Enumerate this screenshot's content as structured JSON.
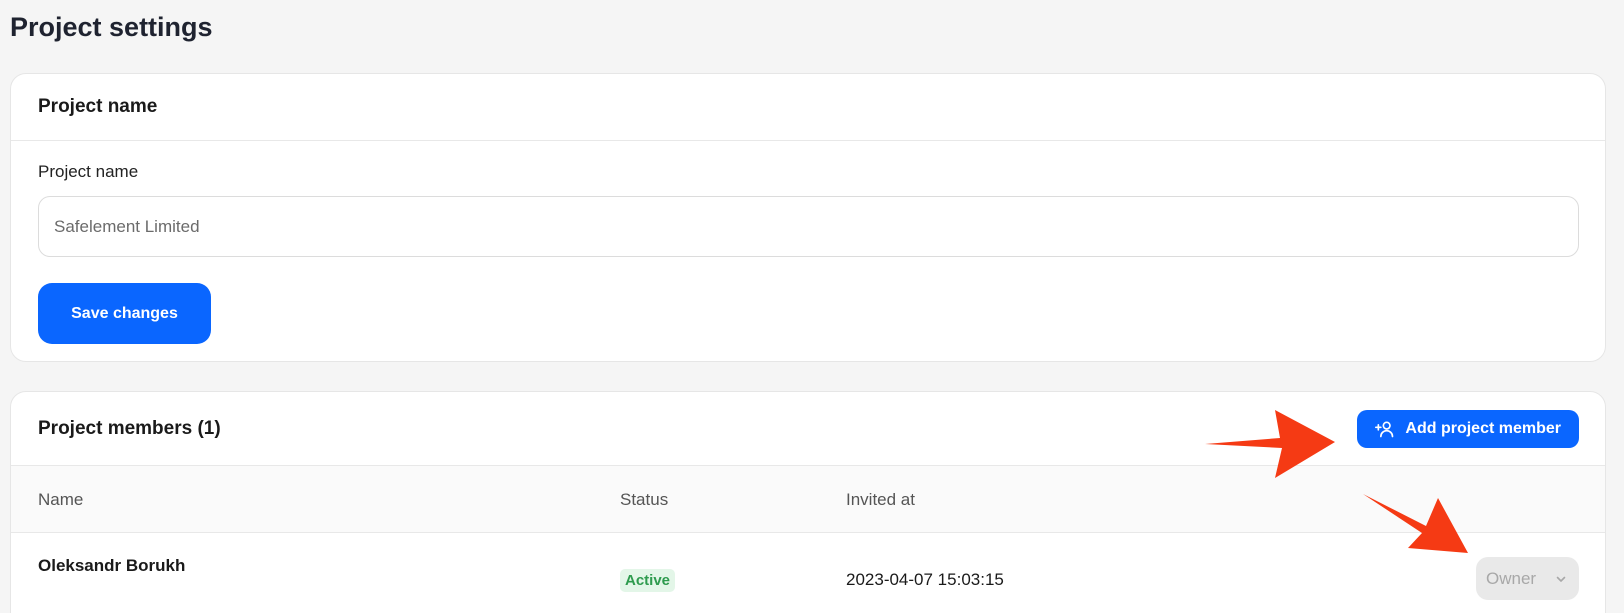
{
  "page": {
    "title": "Project settings"
  },
  "project_name_card": {
    "title": "Project name",
    "field_label": "Project name",
    "field_value": "Safelement Limited",
    "save_label": "Save changes"
  },
  "members_card": {
    "title": "Project members (1)",
    "add_label": "Add project member",
    "columns": {
      "name": "Name",
      "status": "Status",
      "invited": "Invited at"
    },
    "rows": [
      {
        "name": "Oleksandr Borukh",
        "status": "Active",
        "invited_at": "2023-04-07 15:03:15",
        "role": "Owner"
      }
    ]
  },
  "colors": {
    "primary": "#0a66ff",
    "status_active_bg": "#e3f6e8",
    "status_active_text": "#2e9b4e",
    "annotation_arrow": "#f53a14"
  },
  "icons": {
    "add_member": "user-plus-icon",
    "role_dropdown": "chevron-down-icon"
  }
}
